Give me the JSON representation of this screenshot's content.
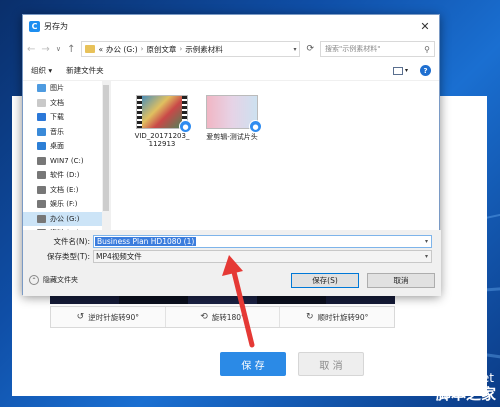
{
  "dialog": {
    "title": "另存为",
    "close_glyph": "✕",
    "nav": {
      "back": "←",
      "forward": "→",
      "up": "↑",
      "history": "∨"
    },
    "breadcrumb": [
      "«",
      "办公 (G:)",
      "原创文章",
      "示例素材料"
    ],
    "search_placeholder": "搜索\"示例素材料\"",
    "toolbar": {
      "organize": "组织 ▾",
      "new_folder": "新建文件夹"
    },
    "sidebar": [
      {
        "label": "图片",
        "icon": "pictures-icon",
        "color": "#4e9be0"
      },
      {
        "label": "文档",
        "icon": "documents-icon",
        "color": "#c9c9c9"
      },
      {
        "label": "下载",
        "icon": "download-icon",
        "color": "#2b78d8"
      },
      {
        "label": "音乐",
        "icon": "music-icon",
        "color": "#3a8ad8"
      },
      {
        "label": "桌面",
        "icon": "desktop-icon",
        "color": "#2c7fd6"
      },
      {
        "label": "WIN7 (C:)",
        "icon": "drive-icon",
        "color": "#777777"
      },
      {
        "label": "软件 (D:)",
        "icon": "drive-icon",
        "color": "#777777"
      },
      {
        "label": "文档 (E:)",
        "icon": "drive-icon",
        "color": "#777777"
      },
      {
        "label": "娱乐 (F:)",
        "icon": "drive-icon",
        "color": "#777777"
      },
      {
        "label": "办公 (G:)",
        "icon": "drive-icon",
        "color": "#777777",
        "selected": true
      },
      {
        "label": "资料 (H:)",
        "icon": "drive-icon",
        "color": "#777777"
      }
    ],
    "files": [
      {
        "name_line1": "VID_20171203_",
        "name_line2": "112913",
        "thumb": "v1"
      },
      {
        "name_line1": "爱剪辑-测试片头",
        "name_line2": "",
        "thumb": "v2"
      }
    ],
    "filename_label": "文件名(N):",
    "filename_value": "Business Plan HD1080 (1)",
    "filetype_label": "保存类型(T):",
    "filetype_value": "MP4视频文件",
    "hide_folders": "隐藏文件夹",
    "save_button": "保存(S)",
    "cancel_button": "取消"
  },
  "background_app": {
    "rotate_ccw": "逆时针旋转90°",
    "rotate_180": "旋转180°",
    "rotate_cw": "顺时针旋转90°",
    "save": "保 存",
    "cancel": "取 消"
  },
  "watermark": {
    "site": "jb51.net",
    "name": "脚本之家"
  },
  "colors": {
    "accent": "#2b8ae6",
    "arrow": "#e53935"
  }
}
